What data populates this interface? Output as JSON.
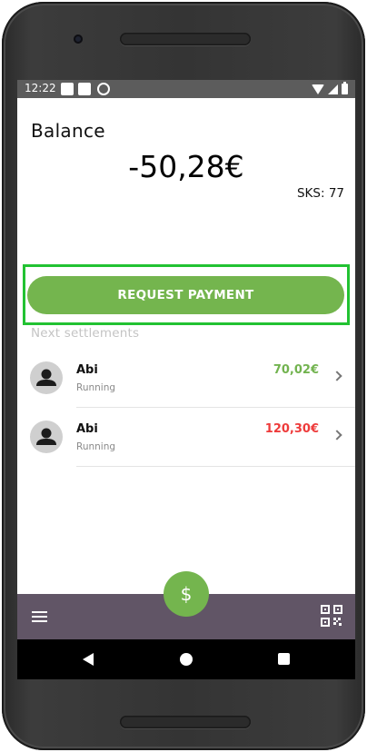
{
  "status_bar": {
    "time": "12:22",
    "notification_icons": [
      "notification-square-icon",
      "notification-square-icon",
      "sync-circle-icon"
    ],
    "system_icons": [
      "wifi-icon",
      "signal-icon",
      "battery-icon"
    ]
  },
  "balance": {
    "label": "Balance",
    "amount": "-50,28€",
    "sks_label": "SKS: 77"
  },
  "actions": {
    "request_payment": "REQUEST PAYMENT"
  },
  "settlements": {
    "section_label": "Next settlements",
    "items": [
      {
        "name": "Abi",
        "status": "Running",
        "amount": "70,02€",
        "amount_color": "#72b34f"
      },
      {
        "name": "Abi",
        "status": "Running",
        "amount": "120,30€",
        "amount_color": "#ee3b3b"
      }
    ]
  },
  "bottom_bar": {
    "fab_symbol": "$",
    "left_icon": "menu-icon",
    "right_icon": "qr-code-icon"
  },
  "colors": {
    "accent_green": "#74b54e",
    "bottom_bar": "#615566",
    "highlight": "#22c232",
    "positive": "#72b34f",
    "negative": "#ee3b3b"
  }
}
